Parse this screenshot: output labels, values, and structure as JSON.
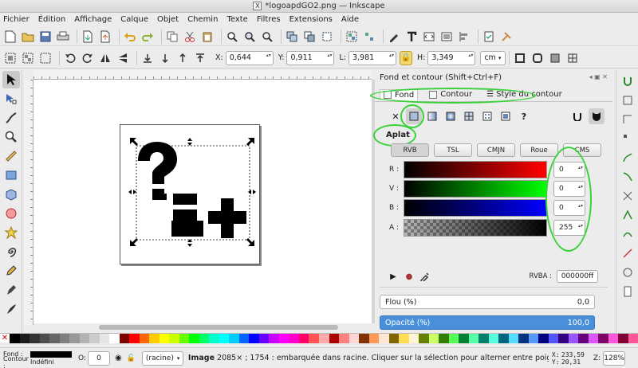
{
  "window": {
    "title": "*logoapdGO2.png — Inkscape"
  },
  "menu": [
    "Fichier",
    "Édition",
    "Affichage",
    "Calque",
    "Objet",
    "Chemin",
    "Texte",
    "Filtres",
    "Extensions",
    "Aide"
  ],
  "controls": {
    "x_label": "X:",
    "x_value": "0,644",
    "y_label": "Y:",
    "y_value": "0,911",
    "w_label": "L:",
    "w_value": "3,981",
    "h_label": "H:",
    "h_value": "3,349",
    "unit": "cm"
  },
  "dialog": {
    "title": "Fond et contour (Shift+Ctrl+F)",
    "tabs": [
      "Fond",
      "Contour",
      "Style du contour"
    ],
    "paint_mode": "Aplat",
    "color_modes": [
      "RVB",
      "TSL",
      "CMJN",
      "Roue",
      "CMS"
    ],
    "channels": [
      {
        "label": "R :",
        "value": "0"
      },
      {
        "label": "V :",
        "value": "0"
      },
      {
        "label": "B :",
        "value": "0"
      },
      {
        "label": "A :",
        "value": "255"
      }
    ],
    "rgba_label": "RVBA :",
    "rgba_value": "000000ff",
    "blur_label": "Flou (%)",
    "blur_value": "0,0",
    "opacity_label": "Opacité (%)",
    "opacity_value": "100,0",
    "highlight_color": "#39d339"
  },
  "status": {
    "fill_label": "Fond :",
    "stroke_label": "Contour :",
    "stroke_value": "Indéfini",
    "opacity_label": "O:",
    "opacity_value": "0",
    "layer": "(racine)",
    "message_bold": "Image",
    "message": " 2085× ; 1754 : embarquée dans racine. Cliquer sur la sélection pour alterner entre poignées de r...",
    "x_label": "X:",
    "x_value": "233,59",
    "y_label": "Y:",
    "y_value": "20,31",
    "zoom_label": "Z:",
    "zoom_value": "128%"
  },
  "palette": [
    "#000000",
    "#1a1a1a",
    "#333333",
    "#4d4d4d",
    "#666666",
    "#808080",
    "#999999",
    "#b3b3b3",
    "#cccccc",
    "#e6e6e6",
    "#ffffff",
    "#800000",
    "#ff0000",
    "#ff6600",
    "#ffcc00",
    "#ffff00",
    "#ccff00",
    "#66ff00",
    "#00ff00",
    "#00ff66",
    "#00ffcc",
    "#00ffff",
    "#00ccff",
    "#0066ff",
    "#0000ff",
    "#6600ff",
    "#cc00ff",
    "#ff00ff",
    "#ff00cc",
    "#ff0066",
    "#ff5555",
    "#ffaaaa",
    "#aa0000",
    "#ff8080",
    "#ffd5d5",
    "#803300",
    "#ff9955",
    "#ffe6d5",
    "#806600",
    "#ffdd55",
    "#fff6d5",
    "#668000",
    "#ccff66",
    "#338000",
    "#55ff55",
    "#008033",
    "#55ffaa",
    "#008066",
    "#55ffdd",
    "#006680",
    "#55ddff",
    "#003380",
    "#5599ff",
    "#000080",
    "#5555ff",
    "#330080",
    "#9955ff",
    "#660080",
    "#dd55ff",
    "#800066",
    "#ff55dd",
    "#800033",
    "#ff5599"
  ]
}
